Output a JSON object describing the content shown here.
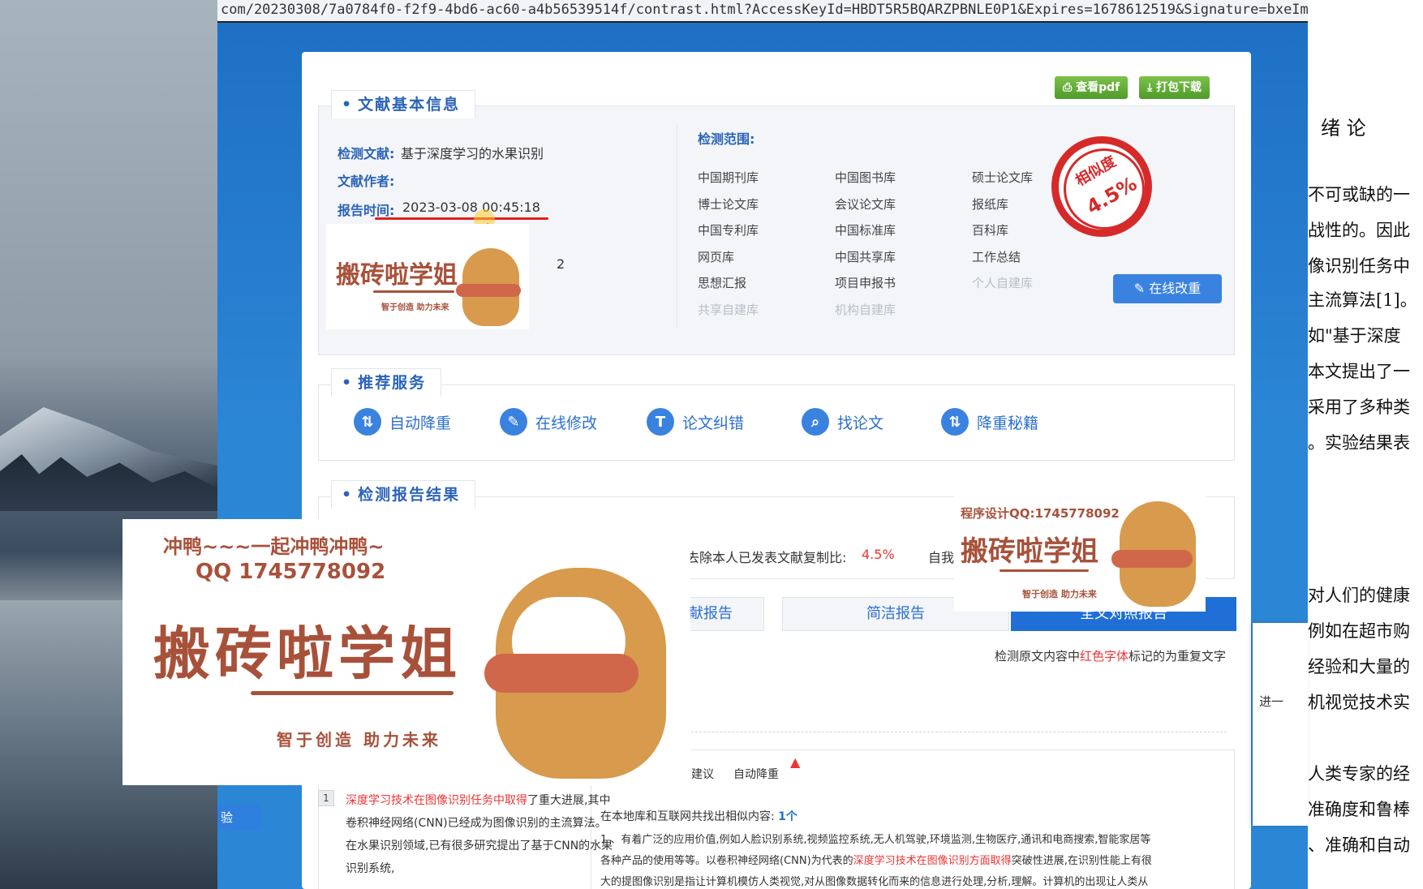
{
  "browser": {
    "url": "com/20230308/7a0784f0-f2f9-4bd6-ac60-a4b56539514f/contrast.html?AccessKeyId=HBDT5R5BQARZPBNLE0P1&Expires=1678612519&Signature=bxeImnT%2052EoQfOK"
  },
  "toolbar": {
    "view_pdf": "查看pdf",
    "download_pack": "打包下载"
  },
  "basic_info": {
    "section_title": "文献基本信息",
    "doc_label": "检测文献:",
    "doc_value": "基于深度学习的水果识别",
    "author_label": "文献作者:",
    "time_label": "报告时间:",
    "time_value": "2023-03-08 00:45:18",
    "hidden_digit": "2",
    "scope_label": "检测范围:",
    "libraries": [
      {
        "name": "中国期刊库",
        "dim": false
      },
      {
        "name": "中国图书库",
        "dim": false
      },
      {
        "name": "硕士论文库",
        "dim": false
      },
      {
        "name": "博士论文库",
        "dim": false
      },
      {
        "name": "会议论文库",
        "dim": false
      },
      {
        "name": "报纸库",
        "dim": false
      },
      {
        "name": "中国专利库",
        "dim": false
      },
      {
        "name": "中国标准库",
        "dim": false
      },
      {
        "name": "百科库",
        "dim": false
      },
      {
        "name": "网页库",
        "dim": false
      },
      {
        "name": "中国共享库",
        "dim": false
      },
      {
        "name": "工作总结",
        "dim": false
      },
      {
        "name": "思想汇报",
        "dim": false
      },
      {
        "name": "项目申报书",
        "dim": false
      },
      {
        "name": "个人自建库",
        "dim": true
      },
      {
        "name": "共享自建库",
        "dim": true
      },
      {
        "name": "机构自建库",
        "dim": true
      }
    ],
    "stamp_label": "相似度",
    "stamp_value": "4.5%",
    "online_edit": "在线改重"
  },
  "services": {
    "section_title": "推荐服务",
    "items": [
      {
        "label": "自动降重",
        "icon": "⇅",
        "name": "auto-reduce"
      },
      {
        "label": "在线修改",
        "icon": "✎",
        "name": "online-edit"
      },
      {
        "label": "论文纠错",
        "icon": "T",
        "name": "paper-correct"
      },
      {
        "label": "找论文",
        "icon": "⌕",
        "name": "find-paper"
      },
      {
        "label": "降重秘籍",
        "icon": "⇅",
        "name": "reduce-tips"
      }
    ]
  },
  "results": {
    "section_title": "检测报告结果",
    "excl_self_label": "去除本人已发表文献复制比:",
    "excl_self_value": "4.5%",
    "self_label": "自我",
    "tabs": [
      "文献报告",
      "简洁报告",
      "全文对照报告"
    ],
    "note_prefix": "检测原文内容中",
    "note_red": "红色字体",
    "note_suffix": "标记的为重复文字",
    "mini_tabs": [
      "修改建议",
      "自动降重"
    ],
    "left_para": {
      "num": "1",
      "red": "深度学习技术在图像识别任务中取得",
      "text1": "了重大进展,其中",
      "text2": "卷积神经网络(CNN)已经成为图像识别的主流算法。",
      "text3": "在水果识别领域,已有很多研究提出了基于CNN的水果",
      "text4": "识别系统,"
    },
    "similar_prefix": "在本地库和互联网共找出相似内容:",
    "similar_count": "1个",
    "right_line1": "1 、有着广泛的应用价值,例如人脸识别系统,视频监控系统,无人机驾驶,环境监测,生物医疗,通讯和电商搜索,智能家居等",
    "right_line2a": "各种产品的使用等等。以卷积神经网络(CNN)为代表的",
    "right_line2red": "深度学习技术在图像识别方面取得",
    "right_line2b": "突破性进展,在识别性能上有很",
    "right_line3": "大的提图像识别是指让计算机模仿人类视觉,对从图像数据转化而来的信息进行处理,分析,理解。计算机的出现让人类从",
    "side_button": "验"
  },
  "watermark": {
    "line1": "冲鸭~~~一起冲鸭冲鸭~",
    "line2": "QQ 1745778092",
    "brand": "搬砖啦学姐",
    "slogan": "智于创造 助力未来",
    "qq_small": "程序设计QQ:1745778092"
  },
  "doc_right": {
    "lines": [
      "绪 论",
      "不可或缺的一",
      "战性的。因此",
      "像识别任务中",
      "主流算法[1]。",
      "如\"基于深度",
      "本文提出了一",
      "采用了多种类",
      "。实验结果表",
      "对人们的健康",
      "例如在超市购",
      "经验和大量的",
      "机视觉技术实",
      "人类专家的经",
      "准确度和鲁棒",
      "、准确和自动"
    ],
    "side_text": "进一"
  },
  "colors": {
    "accent": "#2b63b9",
    "brand": "#a8513a",
    "stamp": "#d62a2a",
    "button_blue": "#3a82e0"
  }
}
